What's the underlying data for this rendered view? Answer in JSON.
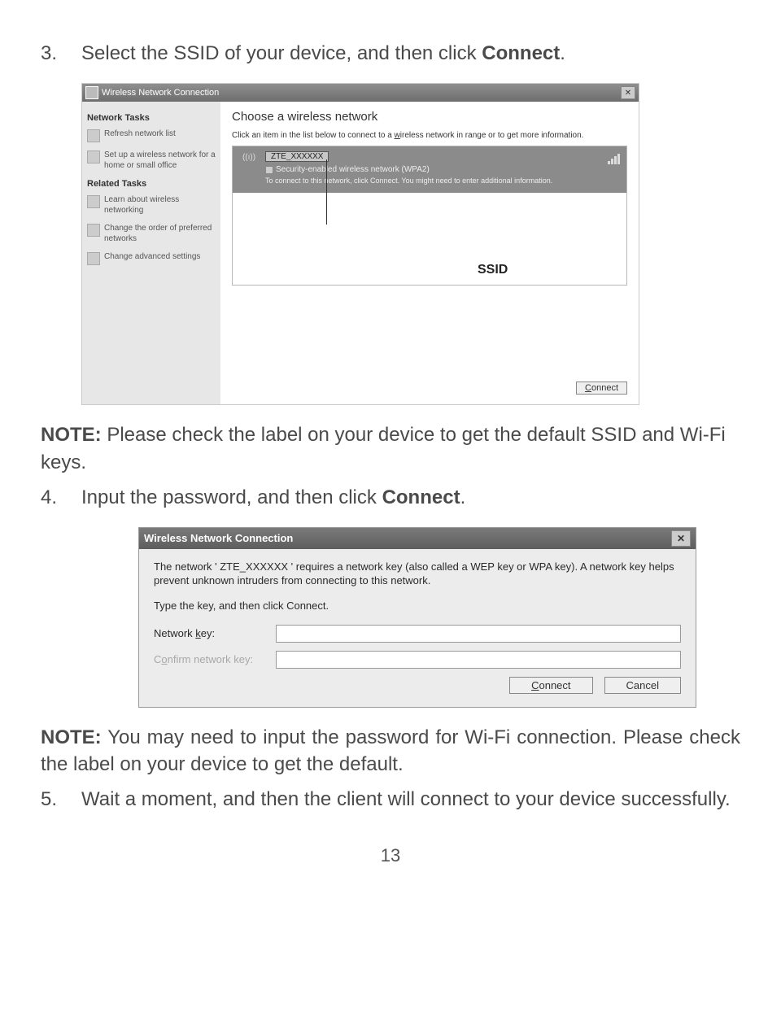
{
  "step3": {
    "num": "3.",
    "text_a": "Select the SSID of your device, and then click ",
    "text_b": "Connect",
    "text_c": "."
  },
  "shot1": {
    "title": "Wireless Network Connection",
    "left": {
      "group1_title": "Network Tasks",
      "refresh": "Refresh network list",
      "setup": "Set up a wireless network for a home or small office",
      "group2_title": "Related Tasks",
      "learn": "Learn about wireless networking",
      "order": "Change the order of preferred networks",
      "adv": "Change advanced settings"
    },
    "right": {
      "title": "Choose a wireless network",
      "sub_a": "Click an item in the list below to connect to a ",
      "sub_u": "w",
      "sub_b": "ireless network in range or to get more information.",
      "ssid": "ZTE_XXXXXX",
      "sec": "Security-enabled wireless network (WPA2)",
      "conn": "To connect to this network, click Connect. You might need to enter additional information.",
      "callout": "SSID",
      "connect_u": "C",
      "connect_rest": "onnect"
    }
  },
  "note1": {
    "label": "NOTE:",
    "text": " Please check the label on your device to get the default SSID and Wi-Fi keys."
  },
  "step4": {
    "num": "4.",
    "text_a": "Input the password, and then click ",
    "text_b": "Connect",
    "text_c": "."
  },
  "shot2": {
    "title": "Wireless Network Connection",
    "para1": "The network ' ZTE_XXXXXX ' requires a network key (also called a WEP key or WPA key). A network key helps prevent unknown intruders from connecting to this network.",
    "para2": "Type the key, and then click Connect.",
    "label1_a": "Network ",
    "label1_u": "k",
    "label1_b": "ey:",
    "label2_a": "C",
    "label2_u": "o",
    "label2_b": "nfirm network key:",
    "btn_connect_u": "C",
    "btn_connect_rest": "onnect",
    "btn_cancel": "Cancel"
  },
  "note2": {
    "label": "NOTE:",
    "text": " You may need to input the password for Wi-Fi connection. Please check the label on your device to get the default."
  },
  "step5": {
    "num": "5.",
    "text": "Wait a moment, and then the client will connect to your device successfully."
  },
  "page_number": "13"
}
